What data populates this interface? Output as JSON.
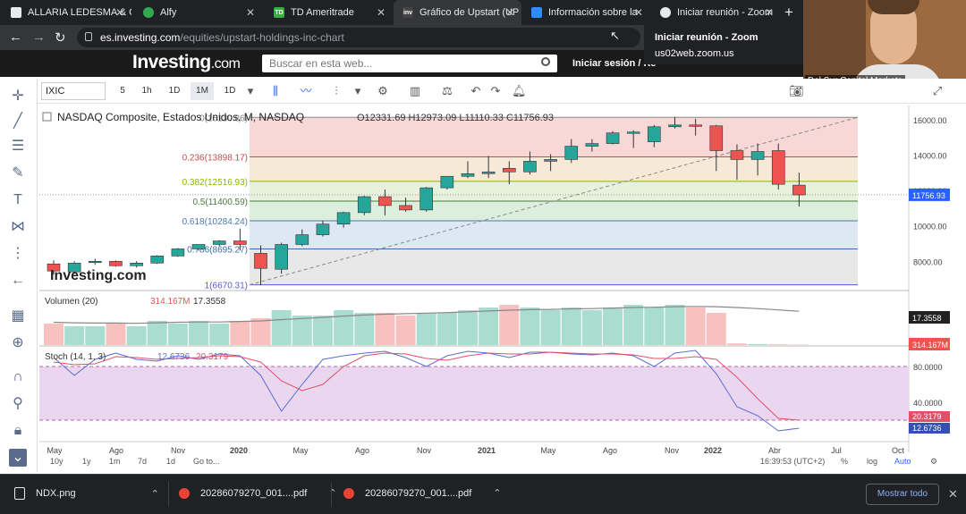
{
  "browser": {
    "tabs": [
      {
        "title": "ALLARIA LEDESMA & C",
        "active": false
      },
      {
        "title": "Alfy",
        "active": false
      },
      {
        "title": "TD Ameritrade",
        "active": false
      },
      {
        "title": "Gráfico de Upstart (UP",
        "active": true
      },
      {
        "title": "Información sobre la",
        "active": false
      },
      {
        "title": "Iniciar reunión - Zoom",
        "active": false
      }
    ],
    "new_tab": "+",
    "url_domain": "es.investing.com",
    "url_path": "/equities/upstart-holdings-inc-chart"
  },
  "zoom_popup": {
    "title": "Iniciar reunión - Zoom",
    "subtitle": "us02web.zoom.us"
  },
  "webcam": {
    "label": "Del Sur Capital Markets"
  },
  "site": {
    "logo": "Investing",
    "logo_suffix": ".com",
    "search_placeholder": "Buscar en esta web...",
    "login": "Iniciar sesión / Re"
  },
  "chart_toolbar": {
    "symbol": "IXIC",
    "intervals": [
      "5",
      "1h",
      "1D",
      "1M",
      "1D"
    ]
  },
  "chart_data": {
    "type": "candlestick",
    "title": "NASDAQ Composite, Estados Unidos, M, NASDAQ",
    "ohlc_header": {
      "O": "12331.69",
      "H": "12973.09",
      "L": "11110.33",
      "C": "11756.93"
    },
    "x_labels": [
      "May",
      "Ago",
      "Nov",
      "2020",
      "May",
      "Ago",
      "Nov",
      "2021",
      "May",
      "Ago",
      "Nov",
      "2022",
      "Abr",
      "Jul",
      "Oct"
    ],
    "y_ticks": [
      "16000.00",
      "14000.00",
      "12000.00",
      "10000.00",
      "8000.00"
    ],
    "last_price": "11756.93",
    "fibonacci": [
      {
        "label": "0(16130.86)",
        "value": 16130.86
      },
      {
        "label": "0.236(13898.17)",
        "value": 13898.17
      },
      {
        "label": "0.382(12516.93)",
        "value": 12516.93
      },
      {
        "label": "0.5(11400.59)",
        "value": 11400.59
      },
      {
        "label": "0.618(10284.24)",
        "value": 10284.24
      },
      {
        "label": "0.786(8695.27)",
        "value": 8695.27
      },
      {
        "label": "1(6670.31)",
        "value": 6670.31
      }
    ],
    "candles": [
      {
        "o": 7850,
        "h": 8050,
        "l": 7250,
        "c": 7450
      },
      {
        "o": 7400,
        "h": 8000,
        "l": 7300,
        "c": 7900
      },
      {
        "o": 7950,
        "h": 8150,
        "l": 7800,
        "c": 8000
      },
      {
        "o": 8000,
        "h": 8050,
        "l": 7700,
        "c": 7750
      },
      {
        "o": 7750,
        "h": 8000,
        "l": 7650,
        "c": 7900
      },
      {
        "o": 7900,
        "h": 8350,
        "l": 7850,
        "c": 8300
      },
      {
        "o": 8300,
        "h": 8750,
        "l": 8250,
        "c": 8700
      },
      {
        "o": 8700,
        "h": 8950,
        "l": 8600,
        "c": 8950
      },
      {
        "o": 8950,
        "h": 9200,
        "l": 8850,
        "c": 9150
      },
      {
        "o": 9150,
        "h": 9850,
        "l": 8600,
        "c": 8950
      },
      {
        "o": 8450,
        "h": 8900,
        "l": 6650,
        "c": 7600
      },
      {
        "o": 7550,
        "h": 9050,
        "l": 7300,
        "c": 8950
      },
      {
        "o": 8950,
        "h": 9800,
        "l": 8850,
        "c": 9500
      },
      {
        "o": 9500,
        "h": 10300,
        "l": 9400,
        "c": 10100
      },
      {
        "o": 10100,
        "h": 10800,
        "l": 9900,
        "c": 10750
      },
      {
        "o": 10750,
        "h": 11700,
        "l": 10600,
        "c": 11650
      },
      {
        "o": 11650,
        "h": 12050,
        "l": 10600,
        "c": 11150
      },
      {
        "o": 11150,
        "h": 11600,
        "l": 10800,
        "c": 10900
      },
      {
        "o": 10900,
        "h": 12200,
        "l": 10800,
        "c": 12150
      },
      {
        "o": 12150,
        "h": 12800,
        "l": 12050,
        "c": 12800
      },
      {
        "o": 12800,
        "h": 13650,
        "l": 12700,
        "c": 12950
      },
      {
        "o": 12950,
        "h": 13950,
        "l": 12700,
        "c": 13050
      },
      {
        "o": 13250,
        "h": 13650,
        "l": 12350,
        "c": 13050
      },
      {
        "o": 13050,
        "h": 14200,
        "l": 12900,
        "c": 13650
      },
      {
        "o": 13650,
        "h": 14050,
        "l": 13100,
        "c": 13750
      },
      {
        "o": 13750,
        "h": 14900,
        "l": 13550,
        "c": 14500
      },
      {
        "o": 14500,
        "h": 14900,
        "l": 14200,
        "c": 14650
      },
      {
        "o": 14650,
        "h": 15350,
        "l": 14600,
        "c": 15250
      },
      {
        "o": 15250,
        "h": 15400,
        "l": 14400,
        "c": 15300
      },
      {
        "o": 14750,
        "h": 15700,
        "l": 14450,
        "c": 15600
      },
      {
        "o": 15600,
        "h": 16150,
        "l": 15500,
        "c": 15700
      },
      {
        "o": 15700,
        "h": 16050,
        "l": 15100,
        "c": 15650
      },
      {
        "o": 15650,
        "h": 15700,
        "l": 13100,
        "c": 14250
      },
      {
        "o": 14250,
        "h": 14600,
        "l": 12600,
        "c": 13750
      },
      {
        "o": 13750,
        "h": 14650,
        "l": 12850,
        "c": 14200
      },
      {
        "o": 14250,
        "h": 14650,
        "l": 12050,
        "c": 12350
      },
      {
        "o": 12300,
        "h": 13000,
        "l": 11100,
        "c": 11750
      }
    ],
    "volume": {
      "label": "Volumen (20)",
      "value1": "314.167M",
      "value2": "17.3558",
      "axis_labels": [
        "17.3558",
        "314.167M"
      ],
      "bars": [
        8,
        7,
        7,
        8,
        7,
        9,
        8,
        9,
        8,
        9,
        10,
        13,
        11,
        11,
        13,
        12,
        12,
        11,
        12,
        12,
        13,
        14,
        15,
        14,
        13,
        14,
        13,
        14,
        15,
        14,
        15,
        14,
        12,
        0.6,
        0.4,
        0.3,
        0.2
      ],
      "sma": [
        8.5,
        8.3,
        8.2,
        8.2,
        8.1,
        8.3,
        8.5,
        8.6,
        8.6,
        8.8,
        9.0,
        9.5,
        9.9,
        10.3,
        10.8,
        11.2,
        11.5,
        11.7,
        11.9,
        12.1,
        12.4,
        12.7,
        13.0,
        13.2,
        13.3,
        13.5,
        13.6,
        13.8,
        14.0,
        14.1,
        14.3,
        14.4,
        14.3,
        14.0,
        13.6,
        13.1,
        12.6
      ]
    },
    "stoch": {
      "label": "Stoch (14, 1, 3)",
      "value1": "12.6736",
      "value2": "20.3179",
      "levels": [
        "80.0000",
        "40.0000"
      ],
      "axis_labels": [
        "20.3179",
        "12.6736"
      ],
      "k": [
        90,
        70,
        88,
        95,
        88,
        86,
        92,
        88,
        94,
        92,
        70,
        30,
        60,
        88,
        92,
        95,
        97,
        90,
        80,
        92,
        97,
        95,
        90,
        96,
        96,
        94,
        93,
        95,
        92,
        80,
        95,
        98,
        72,
        35,
        25,
        8,
        11
      ],
      "d": [
        85,
        82,
        83,
        91,
        90,
        88,
        89,
        90,
        92,
        91,
        85,
        64,
        53,
        60,
        80,
        92,
        95,
        94,
        89,
        87,
        92,
        95,
        94,
        94,
        96,
        95,
        94,
        94,
        93,
        89,
        89,
        91,
        88,
        68,
        44,
        22,
        20
      ]
    },
    "time_display": "16:39:53 (UTC+2)"
  },
  "timeframes": [
    "10y",
    "1y",
    "1m",
    "7d",
    "1d",
    "Go to..."
  ],
  "footer_opts": [
    "%",
    "log",
    "Auto"
  ],
  "downloads": [
    {
      "name": "NDX.png"
    },
    {
      "name": "20286079270_001....pdf"
    },
    {
      "name": "20286079270_001....pdf"
    }
  ],
  "show_all": "Mostrar todo",
  "colors": {
    "up": "#26a69a",
    "down": "#ef5350",
    "accent": "#2962ff"
  }
}
